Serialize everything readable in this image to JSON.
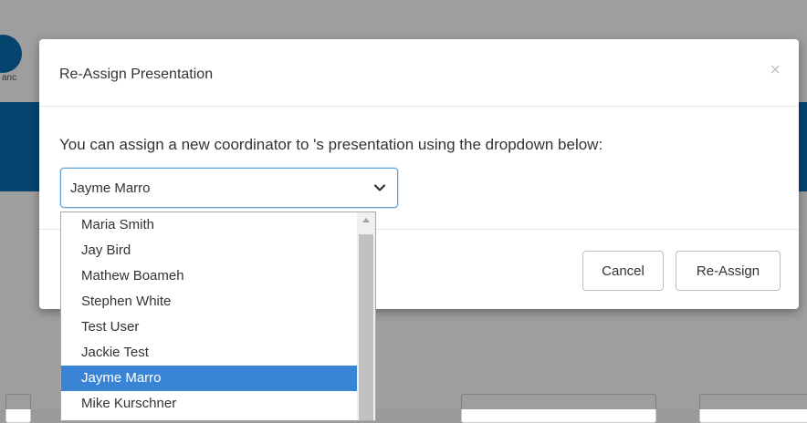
{
  "background": {
    "logo_text": "anc"
  },
  "modal": {
    "title": "Re-Assign Presentation",
    "close_glyph": "×",
    "body_text": "You can assign a new coordinator to 's presentation using the dropdown below:",
    "select": {
      "value": "Jayme Marro",
      "chevron_icon": "chevron-down-icon"
    },
    "buttons": {
      "cancel": "Cancel",
      "reassign": "Re-Assign"
    }
  },
  "dropdown": {
    "options": [
      "Maria Smith",
      "Jay Bird",
      "Mathew Boameh",
      "Stephen White",
      "Test User",
      "Jackie Test",
      "Jayme Marro",
      "Mike Kurschner"
    ],
    "selected_index": 6
  },
  "colors": {
    "brand_blue": "#0a6fb5",
    "selection_blue": "#3a84d6",
    "focus_border": "#5a9fd6"
  }
}
